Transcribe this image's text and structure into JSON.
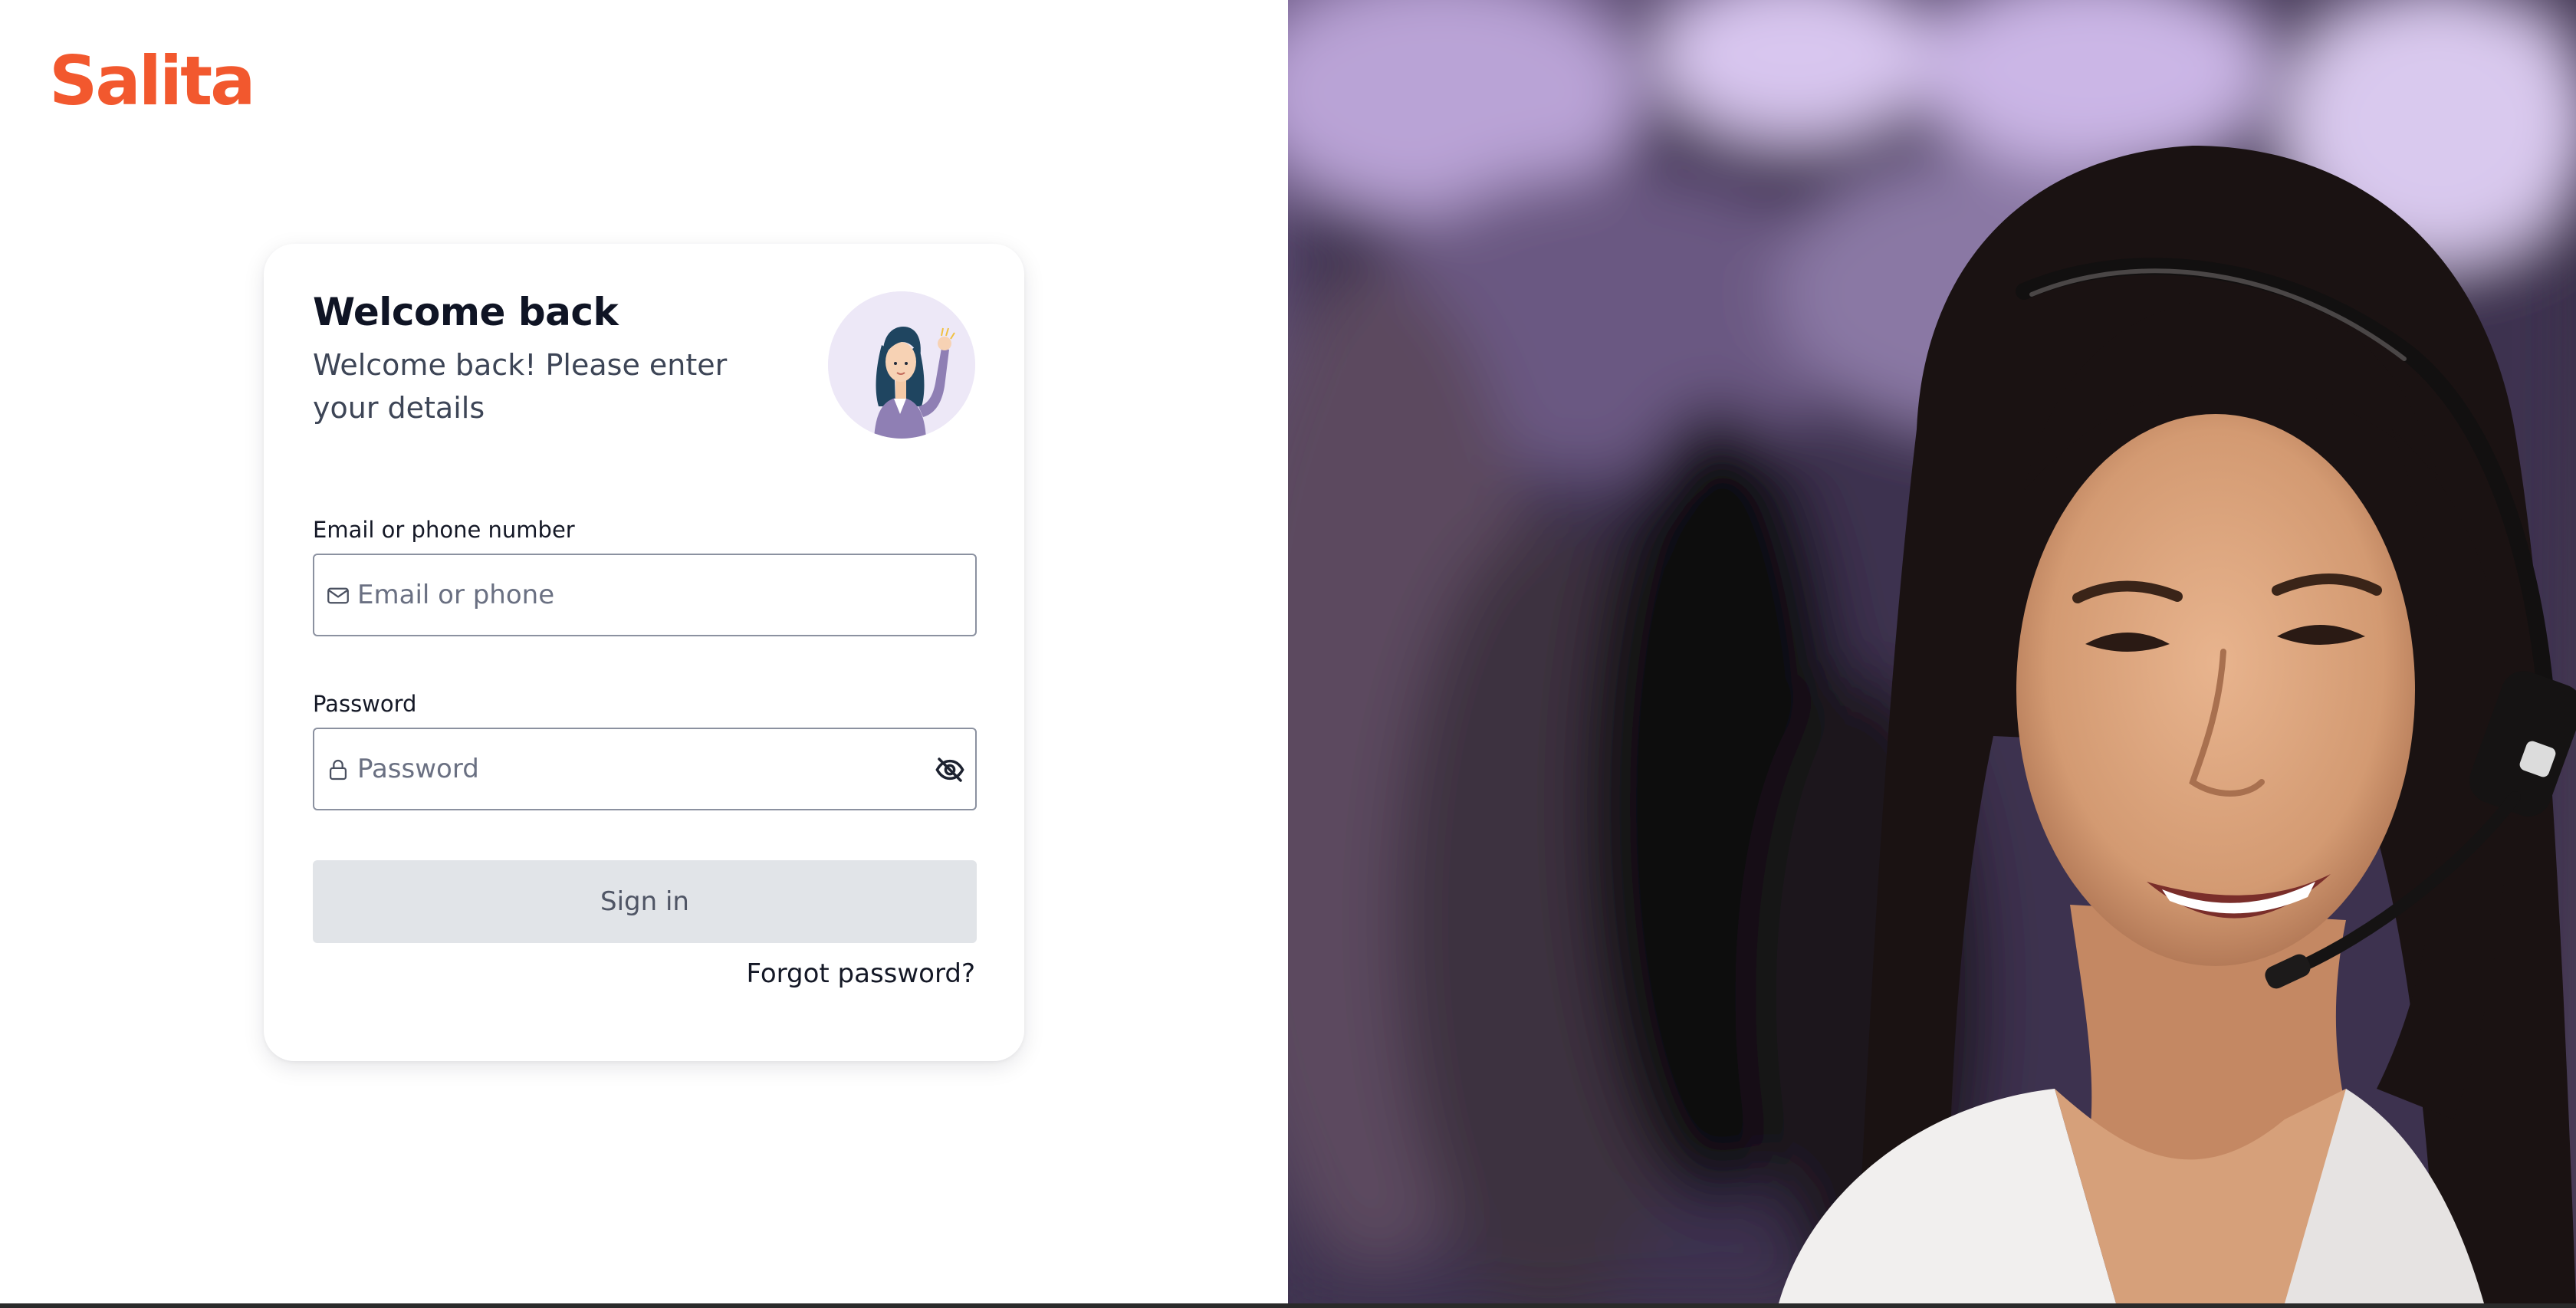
{
  "brand": {
    "logo_text": "Salita",
    "accent_color": "#f2582e"
  },
  "login": {
    "title": "Welcome back",
    "subtitle": "Welcome back! Please enter your details",
    "avatar_icon": "waving-woman-avatar-icon",
    "email": {
      "label": "Email or phone number",
      "placeholder": "Email or phone",
      "value": "",
      "icon": "envelope-icon"
    },
    "password": {
      "label": "Password",
      "placeholder": "Password",
      "value": "",
      "icon": "lock-icon",
      "toggle_icon": "eye-slash-icon"
    },
    "signin_label": "Sign in",
    "forgot_label": "Forgot password?"
  },
  "hero": {
    "image": "smiling-woman-with-headset-photo"
  }
}
